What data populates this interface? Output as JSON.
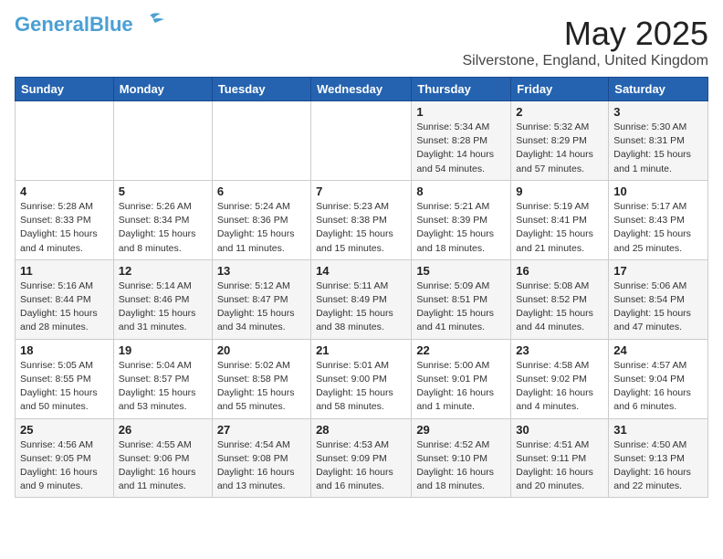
{
  "header": {
    "logo_general": "General",
    "logo_blue": "Blue",
    "month_year": "May 2025",
    "location": "Silverstone, England, United Kingdom"
  },
  "days_of_week": [
    "Sunday",
    "Monday",
    "Tuesday",
    "Wednesday",
    "Thursday",
    "Friday",
    "Saturday"
  ],
  "weeks": [
    [
      {
        "day": "",
        "info": ""
      },
      {
        "day": "",
        "info": ""
      },
      {
        "day": "",
        "info": ""
      },
      {
        "day": "",
        "info": ""
      },
      {
        "day": "1",
        "info": "Sunrise: 5:34 AM\nSunset: 8:28 PM\nDaylight: 14 hours\nand 54 minutes."
      },
      {
        "day": "2",
        "info": "Sunrise: 5:32 AM\nSunset: 8:29 PM\nDaylight: 14 hours\nand 57 minutes."
      },
      {
        "day": "3",
        "info": "Sunrise: 5:30 AM\nSunset: 8:31 PM\nDaylight: 15 hours\nand 1 minute."
      }
    ],
    [
      {
        "day": "4",
        "info": "Sunrise: 5:28 AM\nSunset: 8:33 PM\nDaylight: 15 hours\nand 4 minutes."
      },
      {
        "day": "5",
        "info": "Sunrise: 5:26 AM\nSunset: 8:34 PM\nDaylight: 15 hours\nand 8 minutes."
      },
      {
        "day": "6",
        "info": "Sunrise: 5:24 AM\nSunset: 8:36 PM\nDaylight: 15 hours\nand 11 minutes."
      },
      {
        "day": "7",
        "info": "Sunrise: 5:23 AM\nSunset: 8:38 PM\nDaylight: 15 hours\nand 15 minutes."
      },
      {
        "day": "8",
        "info": "Sunrise: 5:21 AM\nSunset: 8:39 PM\nDaylight: 15 hours\nand 18 minutes."
      },
      {
        "day": "9",
        "info": "Sunrise: 5:19 AM\nSunset: 8:41 PM\nDaylight: 15 hours\nand 21 minutes."
      },
      {
        "day": "10",
        "info": "Sunrise: 5:17 AM\nSunset: 8:43 PM\nDaylight: 15 hours\nand 25 minutes."
      }
    ],
    [
      {
        "day": "11",
        "info": "Sunrise: 5:16 AM\nSunset: 8:44 PM\nDaylight: 15 hours\nand 28 minutes."
      },
      {
        "day": "12",
        "info": "Sunrise: 5:14 AM\nSunset: 8:46 PM\nDaylight: 15 hours\nand 31 minutes."
      },
      {
        "day": "13",
        "info": "Sunrise: 5:12 AM\nSunset: 8:47 PM\nDaylight: 15 hours\nand 34 minutes."
      },
      {
        "day": "14",
        "info": "Sunrise: 5:11 AM\nSunset: 8:49 PM\nDaylight: 15 hours\nand 38 minutes."
      },
      {
        "day": "15",
        "info": "Sunrise: 5:09 AM\nSunset: 8:51 PM\nDaylight: 15 hours\nand 41 minutes."
      },
      {
        "day": "16",
        "info": "Sunrise: 5:08 AM\nSunset: 8:52 PM\nDaylight: 15 hours\nand 44 minutes."
      },
      {
        "day": "17",
        "info": "Sunrise: 5:06 AM\nSunset: 8:54 PM\nDaylight: 15 hours\nand 47 minutes."
      }
    ],
    [
      {
        "day": "18",
        "info": "Sunrise: 5:05 AM\nSunset: 8:55 PM\nDaylight: 15 hours\nand 50 minutes."
      },
      {
        "day": "19",
        "info": "Sunrise: 5:04 AM\nSunset: 8:57 PM\nDaylight: 15 hours\nand 53 minutes."
      },
      {
        "day": "20",
        "info": "Sunrise: 5:02 AM\nSunset: 8:58 PM\nDaylight: 15 hours\nand 55 minutes."
      },
      {
        "day": "21",
        "info": "Sunrise: 5:01 AM\nSunset: 9:00 PM\nDaylight: 15 hours\nand 58 minutes."
      },
      {
        "day": "22",
        "info": "Sunrise: 5:00 AM\nSunset: 9:01 PM\nDaylight: 16 hours\nand 1 minute."
      },
      {
        "day": "23",
        "info": "Sunrise: 4:58 AM\nSunset: 9:02 PM\nDaylight: 16 hours\nand 4 minutes."
      },
      {
        "day": "24",
        "info": "Sunrise: 4:57 AM\nSunset: 9:04 PM\nDaylight: 16 hours\nand 6 minutes."
      }
    ],
    [
      {
        "day": "25",
        "info": "Sunrise: 4:56 AM\nSunset: 9:05 PM\nDaylight: 16 hours\nand 9 minutes."
      },
      {
        "day": "26",
        "info": "Sunrise: 4:55 AM\nSunset: 9:06 PM\nDaylight: 16 hours\nand 11 minutes."
      },
      {
        "day": "27",
        "info": "Sunrise: 4:54 AM\nSunset: 9:08 PM\nDaylight: 16 hours\nand 13 minutes."
      },
      {
        "day": "28",
        "info": "Sunrise: 4:53 AM\nSunset: 9:09 PM\nDaylight: 16 hours\nand 16 minutes."
      },
      {
        "day": "29",
        "info": "Sunrise: 4:52 AM\nSunset: 9:10 PM\nDaylight: 16 hours\nand 18 minutes."
      },
      {
        "day": "30",
        "info": "Sunrise: 4:51 AM\nSunset: 9:11 PM\nDaylight: 16 hours\nand 20 minutes."
      },
      {
        "day": "31",
        "info": "Sunrise: 4:50 AM\nSunset: 9:13 PM\nDaylight: 16 hours\nand 22 minutes."
      }
    ]
  ]
}
